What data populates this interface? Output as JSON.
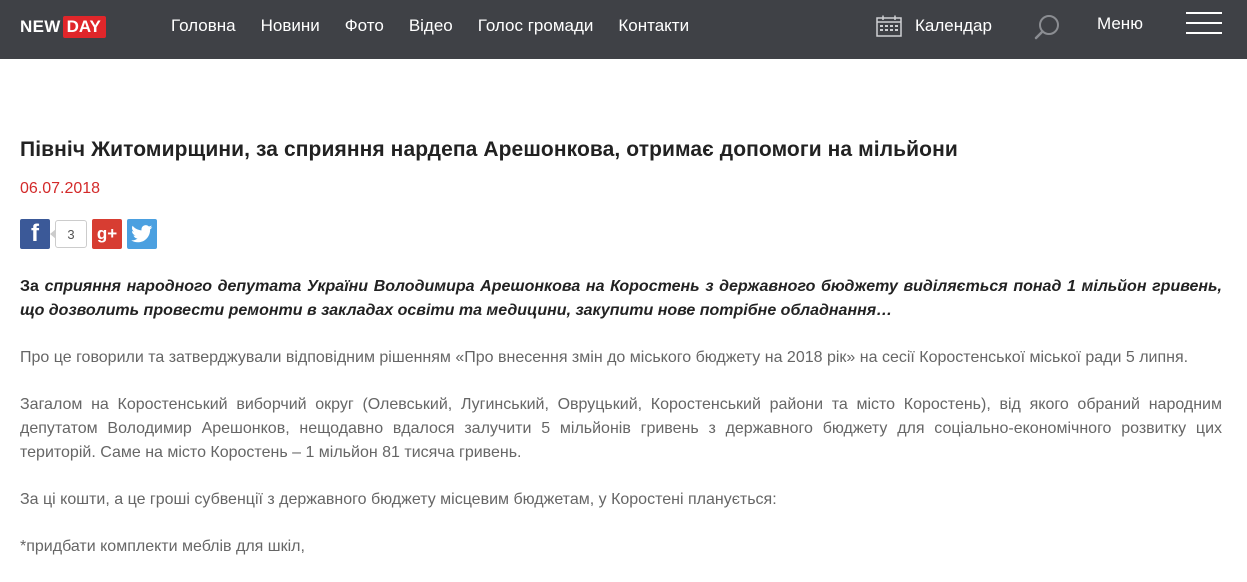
{
  "header": {
    "logo": {
      "new": "NEW",
      "day": "DAY"
    },
    "nav": [
      "Головна",
      "Новини",
      "Фото",
      "Відео",
      "Голос громади",
      "Контакти"
    ],
    "calendar_label": "Календар",
    "menu_label": "Меню"
  },
  "article": {
    "title": "Північ Житомирщини, за сприяння нардепа Арешонкова, отримає допомоги на мільйони",
    "date": "06.07.2018",
    "share": {
      "fb_count": "3"
    },
    "lead_first": "За",
    "lead_rest": " сприяння народного депутата України Володимира Арешонкова на Коростень з державного бюджету виділяється понад 1 мільйон гривень, що дозволить провести ремонти в закладах освіти та медицини, закупити нове потрібне обладнання…",
    "paragraphs": [
      "Про це говорили та затверджували відповідним рішенням «Про внесення змін до міського бюджету на 2018 рік» на сесії Коростенської міської ради 5 липня.",
      "Загалом на Коростенський виборчий округ (Олевський, Лугинський, Овруцький, Коростенський райони та місто Коростень), від якого обраний народним депутатом Володимир  Арешонков, нещодавно вдалося залучити 5 мільйонів гривень з державного бюджету для соціально-економічного розвитку цих територій. Саме на місто Коростень – 1 мільйон 81 тисяча гривень.",
      "За ці кошти, а це гроші субвенції з державного бюджету місцевим бюджетам, у Коростені планується:",
      "*придбати комплекти меблів для шкіл,"
    ]
  }
}
